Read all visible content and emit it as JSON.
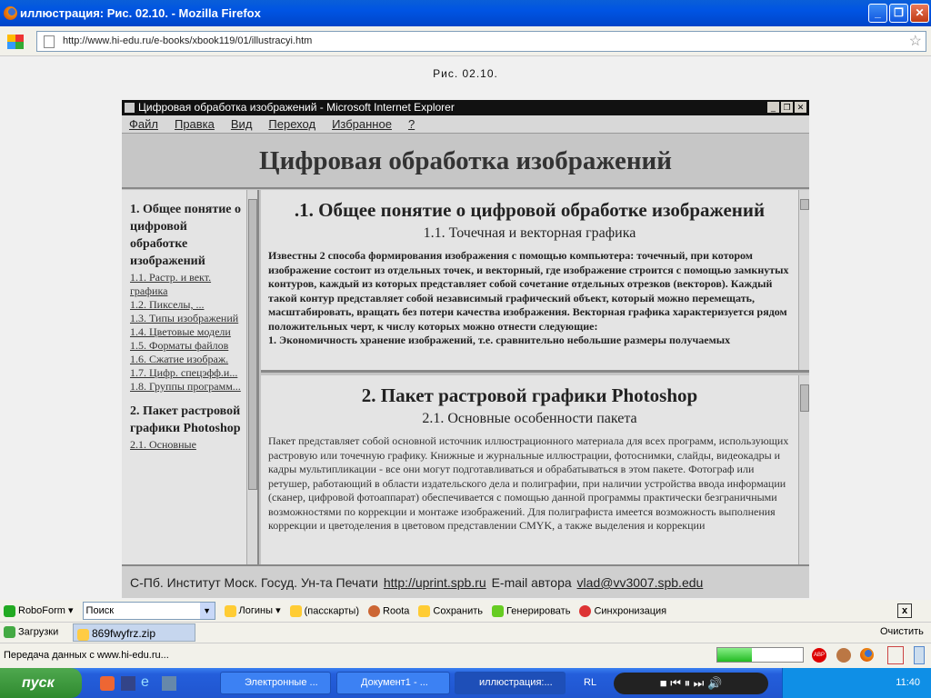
{
  "window": {
    "title": "иллюстрация: Рис. 02.10. - Mozilla Firefox"
  },
  "nav": {
    "url": "http://www.hi-edu.ru/e-books/xbook119/01/illustracyi.htm"
  },
  "page": {
    "caption": "Рис. 02.10."
  },
  "ie": {
    "title": "Цифровая обработка изображений - Microsoft Internet Explorer",
    "menu": [
      "Файл",
      "Правка",
      "Вид",
      "Переход",
      "Избранное",
      "?"
    ],
    "banner": "Цифровая обработка изображений",
    "toc": {
      "s1": "1. Общее понятие о цифровой обработке изображений",
      "links1": [
        "1.1. Растр. и вект. графика",
        "1.2. Пикселы, ...",
        "1.3. Типы изображений",
        "1.4. Цветовые модели",
        "1.5. Форматы файлов",
        "1.6. Сжатие изображ.",
        "1.7. Цифр. спецэфф.и...",
        "1.8. Группы программ..."
      ],
      "s2": "2. Пакет растровой графики Photoshop",
      "links2": [
        "2.1. Основные"
      ]
    },
    "top": {
      "h2": ".1. Общее понятие о цифровой обработке изображений",
      "h3": "1.1. Точечная и векторная графика",
      "text": "Известны 2 способа формирования изображения с помощью компьютера: точечный, при котором изображение состоит из отдельных точек, и векторный, где изображение строится с помощью замкнутых контуров, каждый из которых представляет собой сочетание отдельных отрезков (векторов). Каждый такой контур представляет собой независимый графический объект, который можно перемещать, масштабировать, вращать без потери качества изображения. Векторная графика характеризуется рядом положительных черт, к числу которых можно отнести следующие:",
      "item1": "1. Экономичность хранение изображений, т.е. сравнительно небольшие размеры получаемых"
    },
    "bottom": {
      "h2": "2. Пакет растровой графики Photoshop",
      "h3": "2.1. Основные особенности пакета",
      "text": "Пакет представляет собой основной источник иллюстрационного материала для всех программ, использующих растровую или точечную графику. Книжные и журнальные иллюстрации, фотоснимки, слайды, видеокадры и кадры мультипликации - все они могут подготавливаться и обрабатываться в этом пакете. Фотограф или ретушер, работающий в области издательского дела и полиграфии, при наличии устройства ввода информации (сканер, цифровой фотоаппарат) обеспечивается с помощью данной программы практически безграничными возможностями по коррекции и монтаже изображений. Для полиграфиста имеется возможность выполнения коррекции и цветоделения в цветовом представлении CMYK, а также выделения и коррекции"
    },
    "footer": {
      "text1": "С-Пб. Институт Моск. Госуд. Ун-та Печати",
      "link": "http://uprint.spb.ru",
      "text2": "E-mail автора",
      "email": "vlad@vv3007.spb.edu"
    }
  },
  "roboform": {
    "name": "RoboForm",
    "search": "Поиск",
    "items": [
      "Логины",
      "(пасскарты)",
      "Roota",
      "Сохранить",
      "Генерировать",
      "Синхронизация"
    ]
  },
  "downloads": {
    "label": "Загрузки",
    "file": "869fwyfrz.zip",
    "clear": "Очистить"
  },
  "status": {
    "text": "Передача данных с www.hi-edu.ru...",
    "progress": 0.4
  },
  "taskbar": {
    "start": "пуск",
    "buttons": [
      "Электронные ...",
      "Документ1 - ...",
      "иллюстрация:..."
    ],
    "lang": "RL",
    "clock": "11:40"
  }
}
